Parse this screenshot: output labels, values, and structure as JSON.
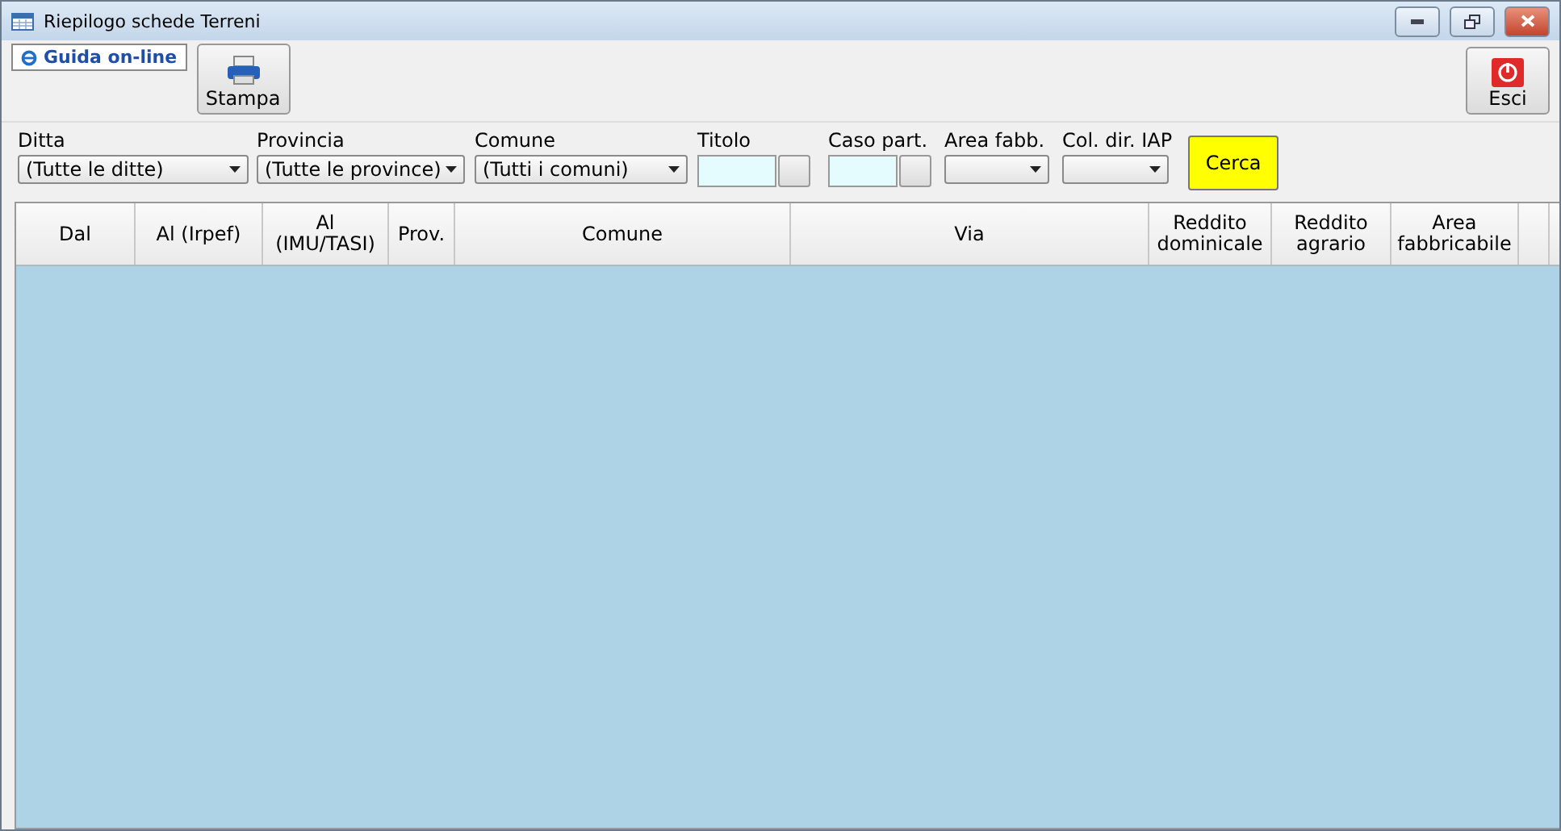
{
  "window": {
    "title": "Riepilogo schede Terreni"
  },
  "toolbar": {
    "help_link": "Guida on-line",
    "print_button": "Stampa",
    "exit_button": "Esci"
  },
  "filters": [
    {
      "kind": "select",
      "label": "Ditta",
      "value": "(Tutte le ditte)"
    },
    {
      "kind": "select",
      "label": "Provincia",
      "value": "(Tutte le province)"
    },
    {
      "kind": "select",
      "label": "Comune",
      "value": "(Tutti i comuni)"
    },
    {
      "kind": "lookup",
      "label": "Titolo"
    },
    {
      "kind": "lookup",
      "label": "Caso part."
    },
    {
      "kind": "select",
      "label": "Area fabb."
    },
    {
      "kind": "select",
      "label": "Col. dir. IAP"
    }
  ],
  "search_button": "Cerca",
  "table": {
    "columns": [
      "Dal",
      "Al (Irpef)",
      "Al\n(IMU/TASI)",
      "Prov.",
      "Comune",
      "Via",
      "Reddito\ndominicale",
      "Reddito\nagrario",
      "Area\nfabbricabile"
    ]
  }
}
